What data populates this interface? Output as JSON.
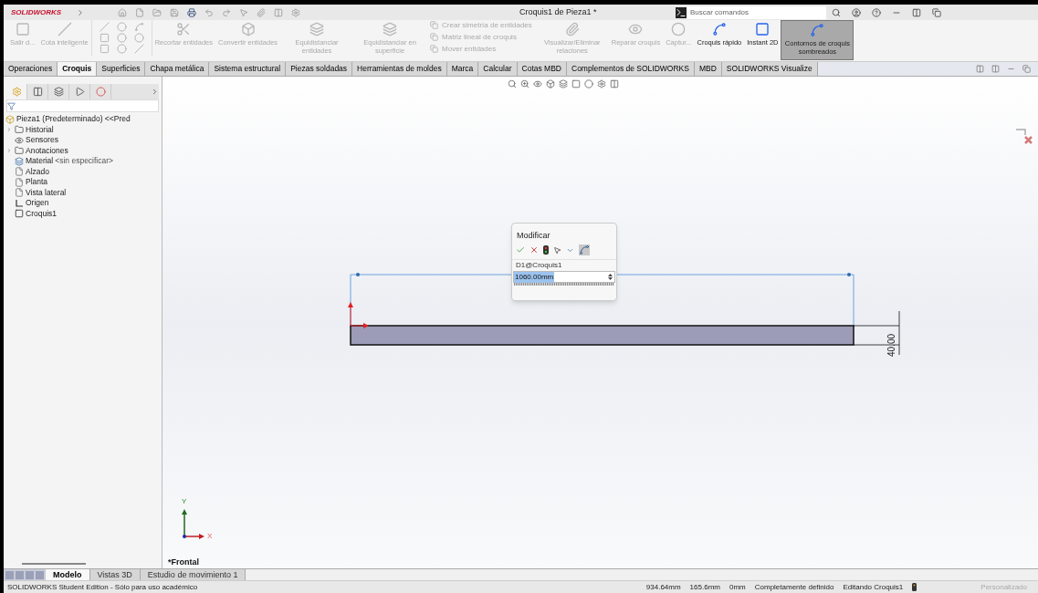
{
  "app": {
    "logo": "SOLIDWORKS",
    "title": "Croquis1 de Pieza1 *",
    "search": {
      "placeholder": "Buscar comandos"
    }
  },
  "ribbon": [
    {
      "kind": "large",
      "label": "Salir d...",
      "disabled": true,
      "pressed": false
    },
    {
      "kind": "large",
      "label": "Cota inteligente",
      "disabled": true,
      "pressed": false
    },
    {
      "kind": "tools"
    },
    {
      "kind": "large",
      "label": "Recortar entidades",
      "disabled": true,
      "pressed": false
    },
    {
      "kind": "large",
      "label": "Convertir entidades",
      "disabled": true,
      "pressed": false
    },
    {
      "kind": "large",
      "label": "Equidistanciar entidades",
      "disabled": true,
      "pressed": false
    },
    {
      "kind": "large",
      "label": "Equidistanciar en superficie",
      "disabled": true,
      "pressed": false
    },
    {
      "kind": "stack",
      "items": [
        "Crear simetría de entidades",
        "Matriz lineal de croquis",
        "Mover entidades"
      ],
      "disabled": true
    },
    {
      "kind": "large",
      "label": "Visualizar/Eliminar relaciones",
      "disabled": true,
      "pressed": false
    },
    {
      "kind": "large",
      "label": "Reparar croquis",
      "disabled": true,
      "pressed": false
    },
    {
      "kind": "large",
      "label": "Captur...",
      "disabled": true,
      "pressed": false
    },
    {
      "kind": "large",
      "label": "Croquis rápido",
      "disabled": false,
      "pressed": false
    },
    {
      "kind": "large",
      "label": "Instant 2D",
      "disabled": false,
      "pressed": false
    },
    {
      "kind": "large",
      "label": "Contornos de croquis sombreados",
      "disabled": false,
      "pressed": true
    }
  ],
  "tabs": [
    {
      "label": "Operaciones",
      "selected": false
    },
    {
      "label": "Croquis",
      "selected": true
    },
    {
      "label": "Superficies",
      "selected": false
    },
    {
      "label": "Chapa metálica",
      "selected": false
    },
    {
      "label": "Sistema estructural",
      "selected": false
    },
    {
      "label": "Piezas soldadas",
      "selected": false
    },
    {
      "label": "Herramientas de moldes",
      "selected": false
    },
    {
      "label": "Marca",
      "selected": false
    },
    {
      "label": "Calcular",
      "selected": false
    },
    {
      "label": "Cotas MBD",
      "selected": false
    },
    {
      "label": "Complementos de SOLIDWORKS",
      "selected": false
    },
    {
      "label": "MBD",
      "selected": false
    },
    {
      "label": "SOLIDWORKS Visualize",
      "selected": false
    }
  ],
  "feature_tree": {
    "root": "Pieza1 (Predeterminado) <<Pred",
    "items": [
      {
        "kind": "folder",
        "label": "Historial",
        "expandable": true
      },
      {
        "kind": "sensor",
        "label": "Sensores",
        "expandable": false
      },
      {
        "kind": "annotation",
        "label": "Anotaciones",
        "expandable": true
      },
      {
        "kind": "material",
        "label": "Material",
        "note": "<sin especificar>",
        "expandable": false
      },
      {
        "kind": "plane",
        "label": "Alzado",
        "expandable": false
      },
      {
        "kind": "plane",
        "label": "Planta",
        "expandable": false
      },
      {
        "kind": "plane",
        "label": "Vista lateral",
        "expandable": false
      },
      {
        "kind": "origin",
        "label": "Origen",
        "expandable": false
      },
      {
        "kind": "sketch",
        "label": "Croquis1",
        "expandable": false
      }
    ]
  },
  "panel_tabs": [
    {
      "selected": true
    },
    {
      "selected": false
    },
    {
      "selected": false
    },
    {
      "selected": false
    },
    {
      "selected": false
    }
  ],
  "viewport": {
    "view_label": "*Frontal",
    "dimension": "40.00",
    "axis_labels": [
      "Y",
      "X"
    ],
    "modify_dialog": {
      "title": "Modificar",
      "name": "D1@Croquis1",
      "value": "1060.00mm"
    }
  },
  "bottom_tabs": [
    {
      "label": "Modelo",
      "selected": true
    },
    {
      "label": "Vistas 3D",
      "selected": false
    },
    {
      "label": "Estudio de movimiento 1",
      "selected": false
    }
  ],
  "status_bar": {
    "text": "SOLIDWORKS Student Edition - Sólo para uso académico",
    "readings": [
      "934.64mm",
      "165.6mm",
      "0mm",
      "Completamente definido",
      "Editando Croquis1"
    ],
    "units": "Personalizado"
  }
}
